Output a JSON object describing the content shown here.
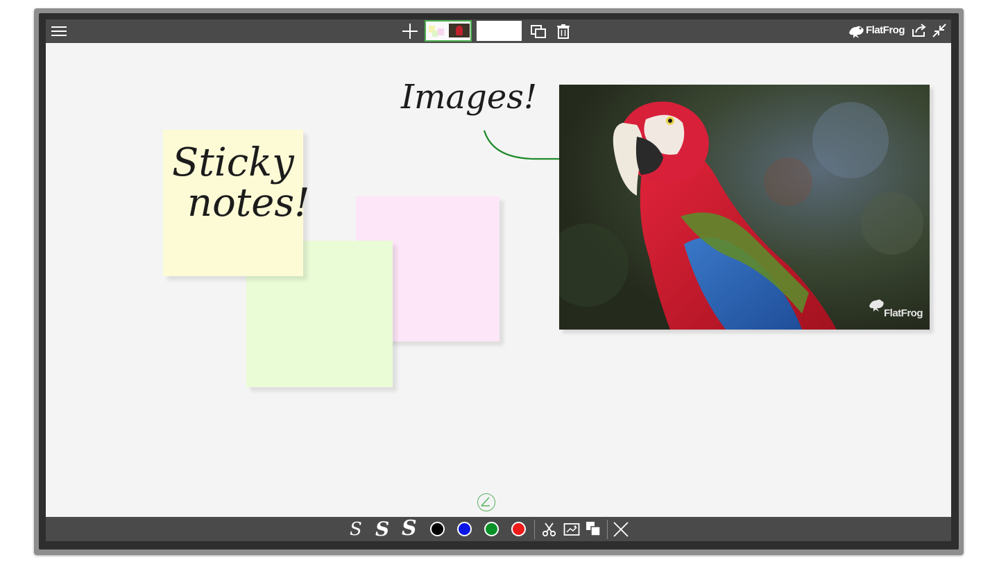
{
  "toolbar_top": {
    "menu_icon": "hamburger-menu-icon",
    "add_page_icon": "plus-icon",
    "page_thumbnails": [
      {
        "state": "active"
      },
      {
        "state": "blank"
      }
    ],
    "duplicate_icon": "duplicate-page-icon",
    "delete_icon": "trash-icon",
    "brand_logo_text": "FlatFrog",
    "share_icon": "share-icon",
    "exit_fullscreen_icon": "shrink-icon"
  },
  "canvas": {
    "sticky_note_text_line1": "Sticky",
    "sticky_note_text_line2": "notes!",
    "sticky_notes_colors": {
      "yellow": "#fdfbd6",
      "green": "#eafcd6",
      "pink": "#fde6f8"
    },
    "handwritten_label": "Images!",
    "arrow_color": "#1e8a2a",
    "image_watermark": "FlatFrog",
    "image_subject": "parrot-photo"
  },
  "toolbar_bottom": {
    "pens": [
      "S",
      "S",
      "S"
    ],
    "pen_sizes": [
      "thin",
      "medium",
      "thick"
    ],
    "colors": [
      "#000000",
      "#0b16e6",
      "#079127",
      "#ee1b1b"
    ],
    "tools": [
      "scissors-icon",
      "screenshot-icon",
      "layers-icon",
      "close-icon"
    ]
  },
  "hint_icon": "pen-hint-icon"
}
